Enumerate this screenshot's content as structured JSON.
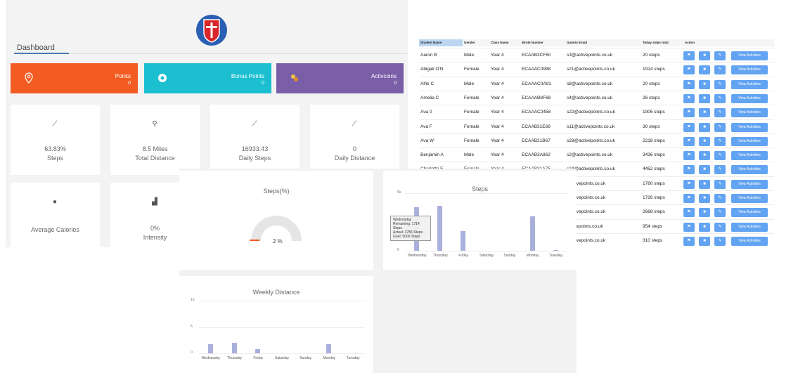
{
  "dashboard": {
    "title": "Dashboard",
    "cards": [
      {
        "label": "Points",
        "value": "0",
        "color": "#f25c22",
        "icon": "map-pin-icon"
      },
      {
        "label": "Bonus Points",
        "value": "0",
        "color": "#1bbfd0",
        "icon": "gear-icon"
      },
      {
        "label": "Activcoins",
        "value": "0",
        "color": "#7a5fa8",
        "icon": "coins-icon"
      }
    ],
    "metrics": [
      {
        "value": "63.83%",
        "label": "Steps",
        "icon": "chart-line-icon"
      },
      {
        "value": "8.5 Miles",
        "label": "Total Distance",
        "icon": "location-icon"
      },
      {
        "value": "16933.43",
        "label": "Daily Steps",
        "icon": "chart-line-icon"
      },
      {
        "value": "0",
        "label": "Daily Distance",
        "icon": "chart-line-icon"
      }
    ],
    "metrics2": [
      {
        "value": "",
        "label": "Average Calories",
        "icon": "apple-icon"
      },
      {
        "value": "0%",
        "label": "Intensity",
        "icon": "area-chart-icon"
      }
    ]
  },
  "table": {
    "headers": [
      "Student Name",
      "Gender",
      "Class Name",
      "Wrote Number",
      "Garmin Email",
      "Today steps total",
      "Action"
    ],
    "view_label": "View Activities",
    "rows": [
      {
        "name": "Aaron B",
        "gender": "Male",
        "class": "Year 4",
        "number": "ECAAB3CF50",
        "email": "s3@activepoints.co.uk",
        "steps": "20 steps"
      },
      {
        "name": "Abigail O'N",
        "gender": "Female",
        "class": "Year 4",
        "number": "ECAAAC0998",
        "email": "s21@activepoints.co.uk",
        "steps": "1914 steps"
      },
      {
        "name": "Alfie C",
        "gender": "Male",
        "class": "Year 4",
        "number": "ECAAAC0A91",
        "email": "s8@activepoints.co.uk",
        "steps": "20 steps"
      },
      {
        "name": "Amelia C",
        "gender": "Female",
        "class": "Year 4",
        "number": "ECAAAB8F68",
        "email": "s4@activepoints.co.uk",
        "steps": "26 steps"
      },
      {
        "name": "Ava 0",
        "gender": "Female",
        "class": "Year 4",
        "number": "ECAAAC2458",
        "email": "s22@activepoints.co.uk",
        "steps": "1906 steps"
      },
      {
        "name": "Ava F",
        "gender": "Female",
        "class": "Year 4",
        "number": "ECAAB31E69",
        "email": "s11@activepoints.co.uk",
        "steps": "30 steps"
      },
      {
        "name": "Ava W",
        "gender": "Female",
        "class": "Year 4",
        "number": "ECAAB21B67",
        "email": "s28@activepoints.co.uk",
        "steps": "2218 steps"
      },
      {
        "name": "Benjamin A",
        "gender": "Male",
        "class": "Year 4",
        "number": "ECAAB3A862",
        "email": "s2@activepoints.co.uk",
        "steps": "3436 steps"
      },
      {
        "name": "Charlotte F",
        "gender": "Female",
        "class": "Year 4",
        "number": "ECAAB31A75",
        "email": "s24@activepoints.co.uk",
        "steps": "4452 steps"
      },
      {
        "name": "",
        "gender": "",
        "class": "",
        "number": "",
        "email": "?activepoints.co.uk",
        "steps": "1760 steps"
      },
      {
        "name": "",
        "gender": "",
        "class": "",
        "number": "",
        "email": "?activepoints.co.uk",
        "steps": "1726 steps"
      },
      {
        "name": "",
        "gender": "",
        "class": "",
        "number": "",
        "email": "?activepoints.co.uk",
        "steps": "2668 steps"
      },
      {
        "name": "",
        "gender": "",
        "class": "",
        "number": "",
        "email": "activepoints.co.uk",
        "steps": "954 steps"
      },
      {
        "name": "",
        "gender": "",
        "class": "",
        "number": "",
        "email": "?activepoints.co.uk",
        "steps": "310 steps"
      }
    ]
  },
  "charts": {
    "gauge": {
      "title": "Steps(%)",
      "value_label": "2 %"
    },
    "tooltip": [
      "Wednesday",
      "Remaining: 1714 Steps",
      "Actual: 3786 Steps",
      "Goal: 5000 Steps"
    ]
  },
  "chart_data": [
    {
      "type": "bar",
      "title": "Steps",
      "categories": [
        "Wednesday",
        "Thursday",
        "Friday",
        "Saturday",
        "Sunday",
        "Monday",
        "Tuesday"
      ],
      "values": [
        3786,
        3900,
        1700,
        0,
        0,
        3000,
        80
      ],
      "ylim": [
        0,
        5000
      ],
      "yticks": [
        "0",
        "5k"
      ]
    },
    {
      "type": "bar",
      "title": "Weekly Distance",
      "categories": [
        "Wednesday",
        "Thursday",
        "Friday",
        "Saturday",
        "Sunday",
        "Monday",
        "Tuesday"
      ],
      "values": [
        1.8,
        2.0,
        0.8,
        0,
        0,
        1.7,
        0
      ],
      "ylim": [
        0,
        10
      ],
      "yticks": [
        "0",
        "5",
        "10"
      ]
    }
  ]
}
